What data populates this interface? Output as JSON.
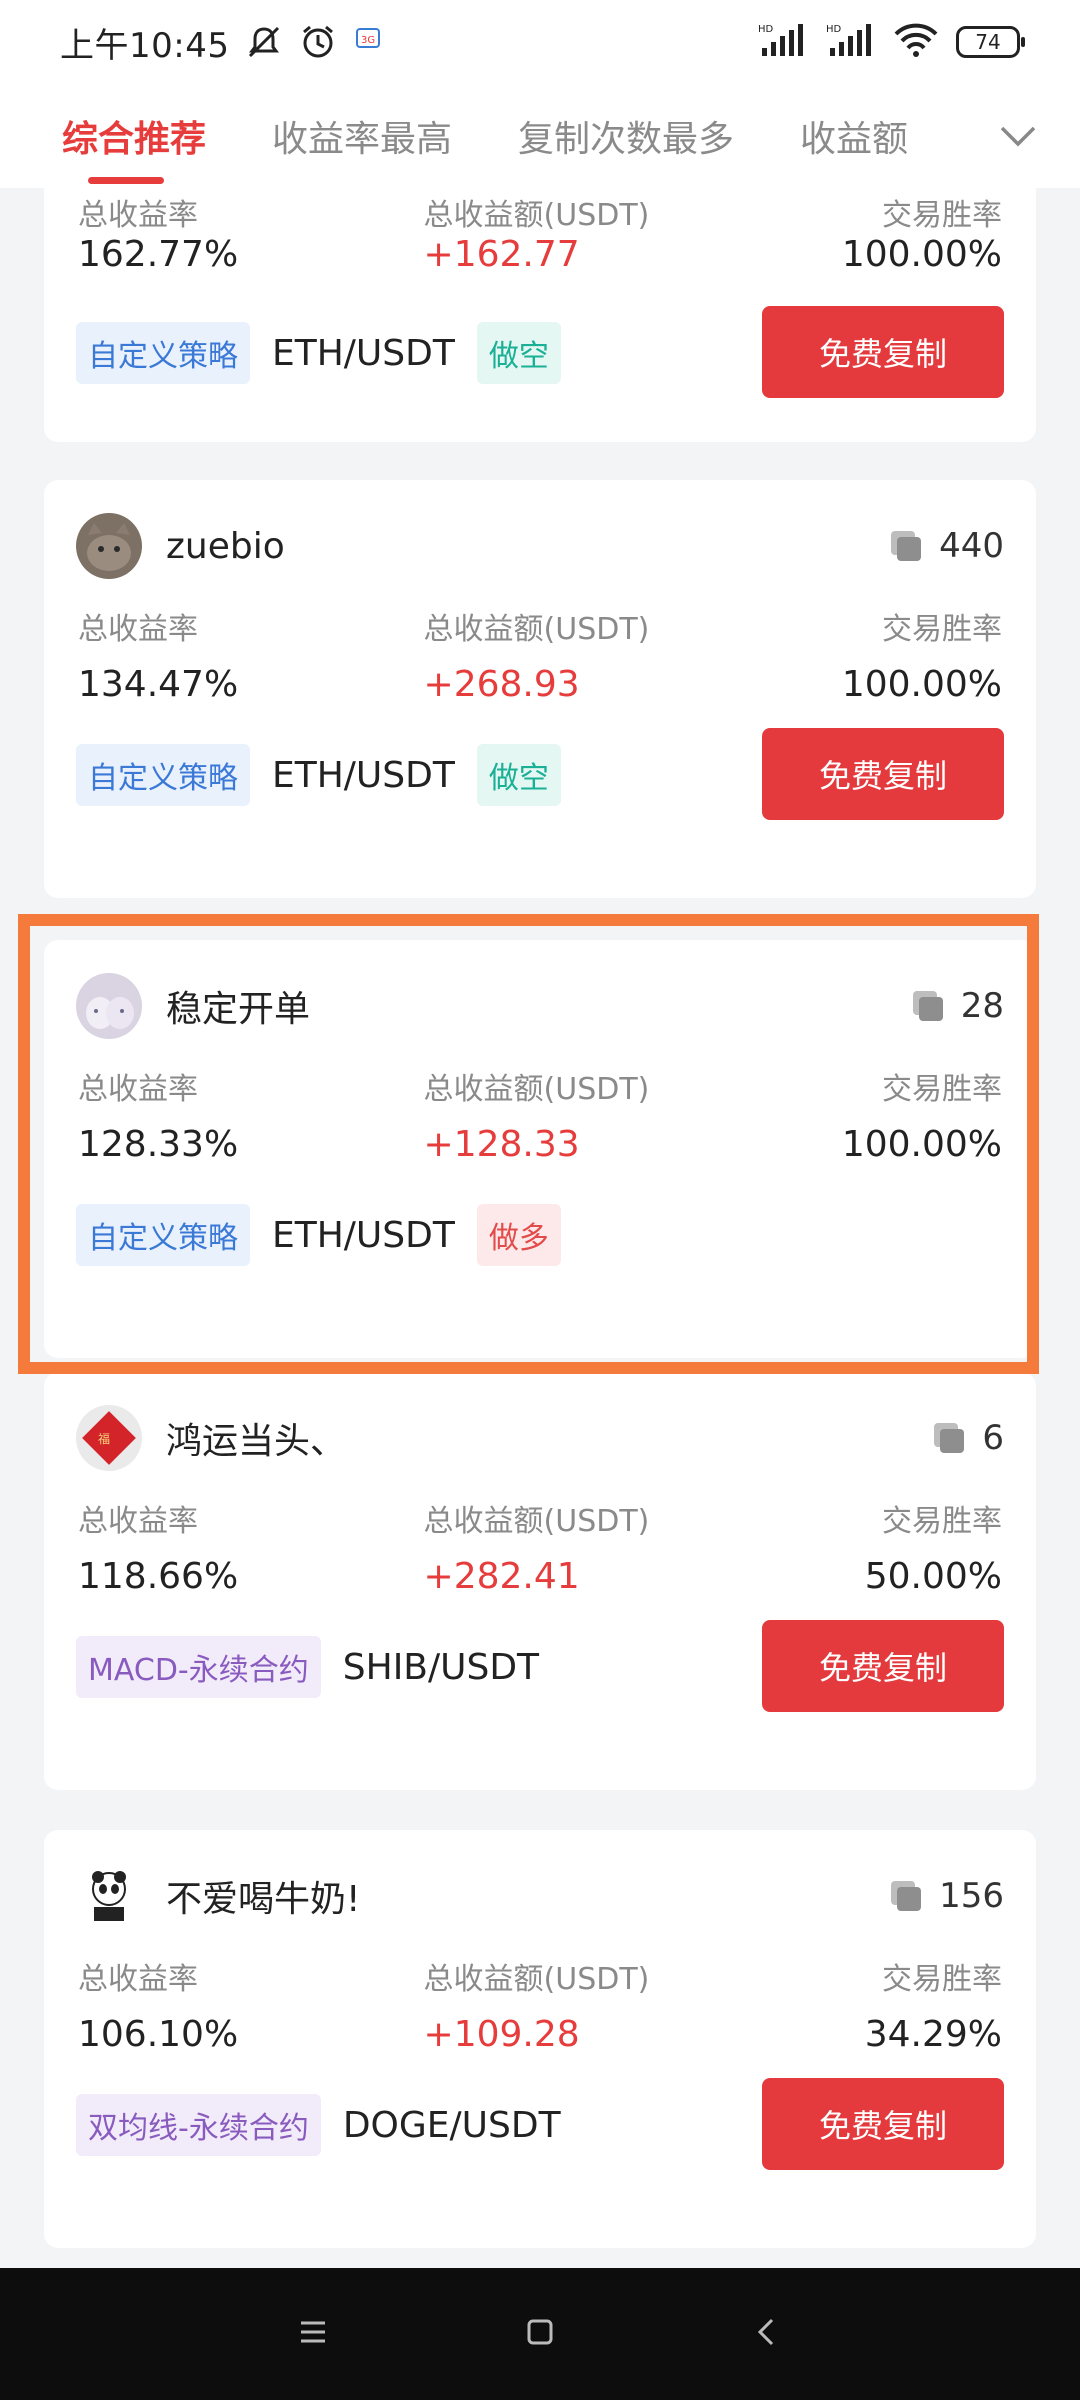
{
  "status_bar": {
    "time": "上午10:45",
    "battery": "74",
    "icons": [
      "mute-icon",
      "alarm-icon",
      "app-notification-icon",
      "hd-signal-icon",
      "hd-signal-icon-2",
      "wifi-icon",
      "battery-icon"
    ]
  },
  "tabs": {
    "items": [
      "综合推荐",
      "收益率最高",
      "复制次数最多",
      "收益额"
    ],
    "active_index": 0,
    "more_icon": "chevron-down-icon"
  },
  "stat_labels": {
    "yield_rate": "总收益率",
    "total_profit": "总收益额(USDT)",
    "win_rate": "交易胜率"
  },
  "copy_button_label": "免费复制",
  "traders": [
    {
      "name": "",
      "copies": "",
      "yield_rate": "162.77%",
      "total_profit": "+162.77",
      "win_rate": "100.00%",
      "strategy": "自定义策略",
      "pair": "ETH/USDT",
      "direction": "做空"
    },
    {
      "name": "zuebio",
      "copies": "440",
      "yield_rate": "134.47%",
      "total_profit": "+268.93",
      "win_rate": "100.00%",
      "strategy": "自定义策略",
      "pair": "ETH/USDT",
      "direction": "做空"
    },
    {
      "name": "稳定开单",
      "copies": "28",
      "yield_rate": "128.33%",
      "total_profit": "+128.33",
      "win_rate": "100.00%",
      "strategy": "自定义策略",
      "pair": "ETH/USDT",
      "direction": "做多"
    },
    {
      "name": "鸿运当头、",
      "copies": "6",
      "yield_rate": "118.66%",
      "total_profit": "+282.41",
      "win_rate": "50.00%",
      "strategy": "MACD-永续合约",
      "pair": "SHIB/USDT",
      "direction": ""
    },
    {
      "name": "不爱喝牛奶!",
      "copies": "156",
      "yield_rate": "106.10%",
      "total_profit": "+109.28",
      "win_rate": "34.29%",
      "strategy": "双均线-永续合约",
      "pair": "DOGE/USDT",
      "direction": ""
    }
  ],
  "colors": {
    "accent_red": "#e63c3c",
    "button_red": "#e43a3d",
    "highlight_orange": "#f57b3c",
    "page_bg": "#f3f4f6"
  },
  "nav_bar": {
    "icons": [
      "menu-icon",
      "home-icon",
      "back-icon"
    ]
  }
}
